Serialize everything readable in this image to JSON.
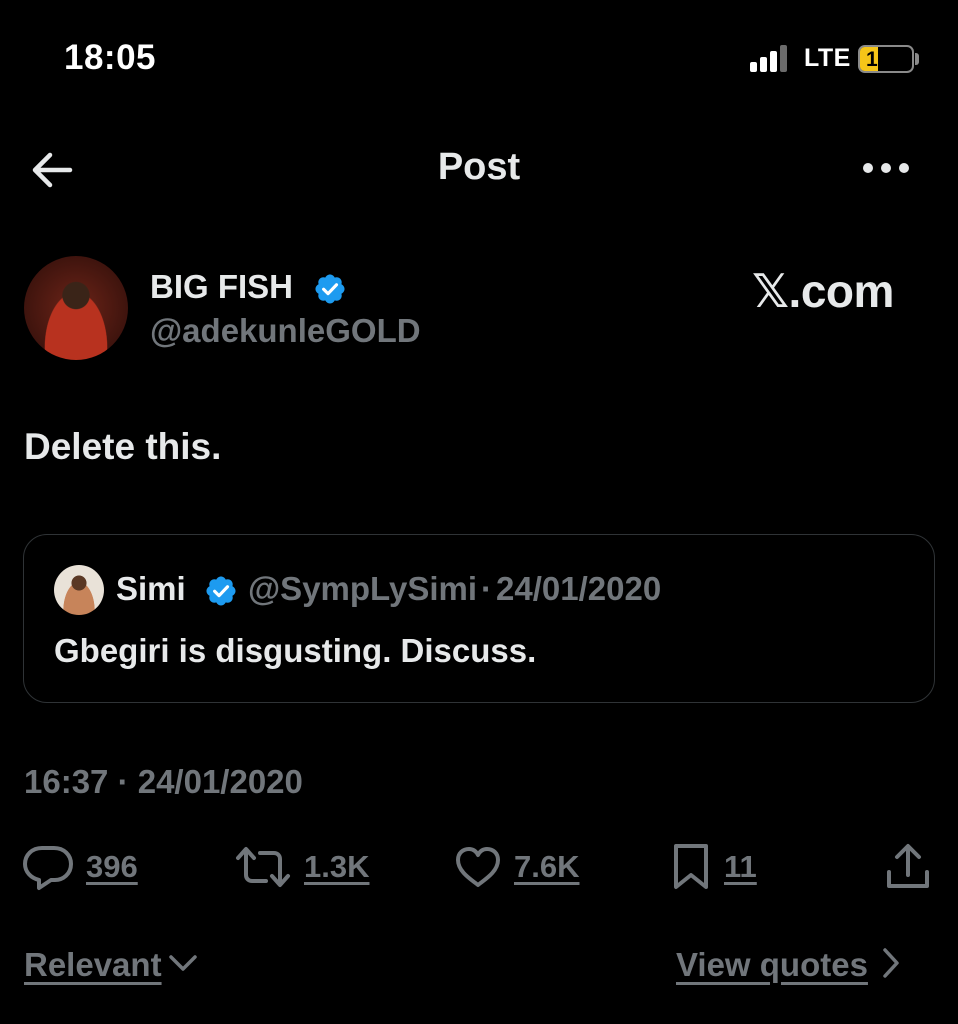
{
  "status_bar": {
    "time": "18:05",
    "network": "LTE",
    "battery_level": "17",
    "battery_percent": 17,
    "battery_color": "#f5c518"
  },
  "header": {
    "back_icon": "arrow-left-icon",
    "title": "Post",
    "more_icon": "more-horizontal-icon"
  },
  "post": {
    "author": {
      "name": "BIG FISH",
      "handle": "@adekunleGOLD",
      "verified": true
    },
    "watermark": "𝕏.com",
    "text": "Delete this.",
    "quote": {
      "name": "Simi",
      "verified": true,
      "handle": "@SympLySimi",
      "separator": "·",
      "date": "24/01/2020",
      "text": "Gbegiri is disgusting. Discuss."
    },
    "timestamp": "16:37 · 24/01/2020"
  },
  "actions": {
    "replies": "396",
    "reposts": "1.3K",
    "likes": "7.6K",
    "bookmarks": "11"
  },
  "footer": {
    "sort_label": "Relevant",
    "view_quotes_label": "View quotes"
  },
  "colors": {
    "background": "#000000",
    "text_primary": "#e7e9ea",
    "text_secondary": "#71767b",
    "verified_blue": "#1d9bf0",
    "border": "#2f3336"
  }
}
